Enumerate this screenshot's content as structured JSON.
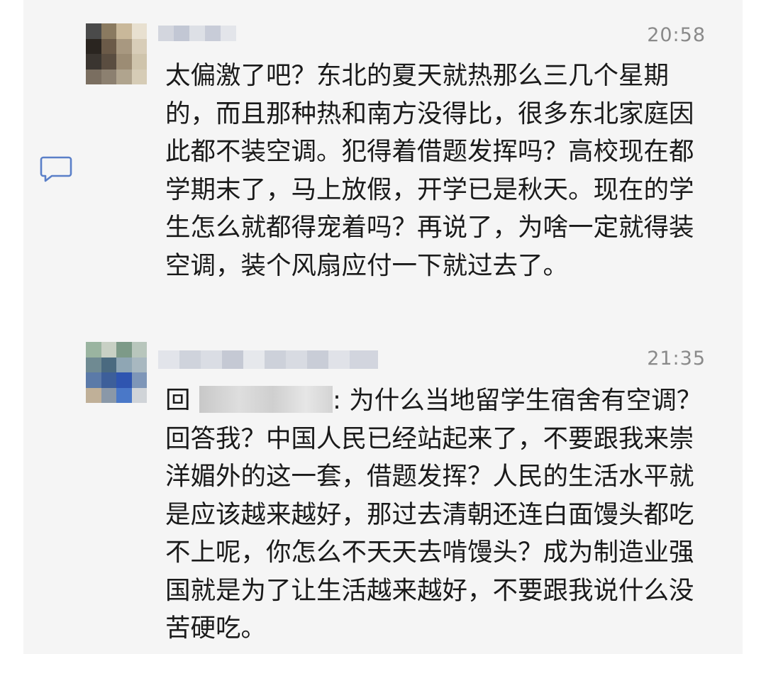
{
  "comments": [
    {
      "time": "20:58",
      "text": "太偏激了吧？东北的夏天就热那么三几个星期的，而且那种热和南方没得比，很多东北家庭因此都不装空调。犯得着借题发挥吗？高校现在都学期末了，马上放假，开学已是秋天。现在的学生怎么就都得宠着吗？再说了，为啥一定就得装空调，装个风扇应付一下就过去了。",
      "avatar_colors": [
        "#4a4a4a",
        "#8a7a60",
        "#c9b89a",
        "#e8e0d0",
        "#2a2520",
        "#6b5a48",
        "#a89880",
        "#d8cdb8",
        "#3a3530",
        "#5a4d40",
        "#9c8c74",
        "#cfc4ac",
        "#7a6e60",
        "#8c8070",
        "#b0a48e",
        "#d6ccb6"
      ]
    },
    {
      "time": "21:35",
      "reply_prefix": "回复",
      "text": ": 为什么当地留学生宿舍有空调？回答我？中国人民已经站起来了，不要跟我来崇洋媚外的这一套，借题发挥？人民的生活水平就是应该越来越好，那过去清朝还连白面馒头都吃不上呢，你怎么不天天去啃馒头？成为制造业强国就是为了让生活越来越好，不要跟我说什么没苦硬吃。",
      "avatar_colors": [
        "#9ab4a0",
        "#c8d0c4",
        "#7d9a88",
        "#b8c6bc",
        "#6f8a92",
        "#4a6a80",
        "#8fa6b4",
        "#a8b8c0",
        "#5b7aa8",
        "#3d5f9a",
        "#2f55b0",
        "#7e96b8",
        "#c0b098",
        "#8a98a8",
        "#4a78c8",
        "#d0d4d8"
      ]
    }
  ],
  "icons": {
    "reply": "comment-bubble-icon"
  }
}
